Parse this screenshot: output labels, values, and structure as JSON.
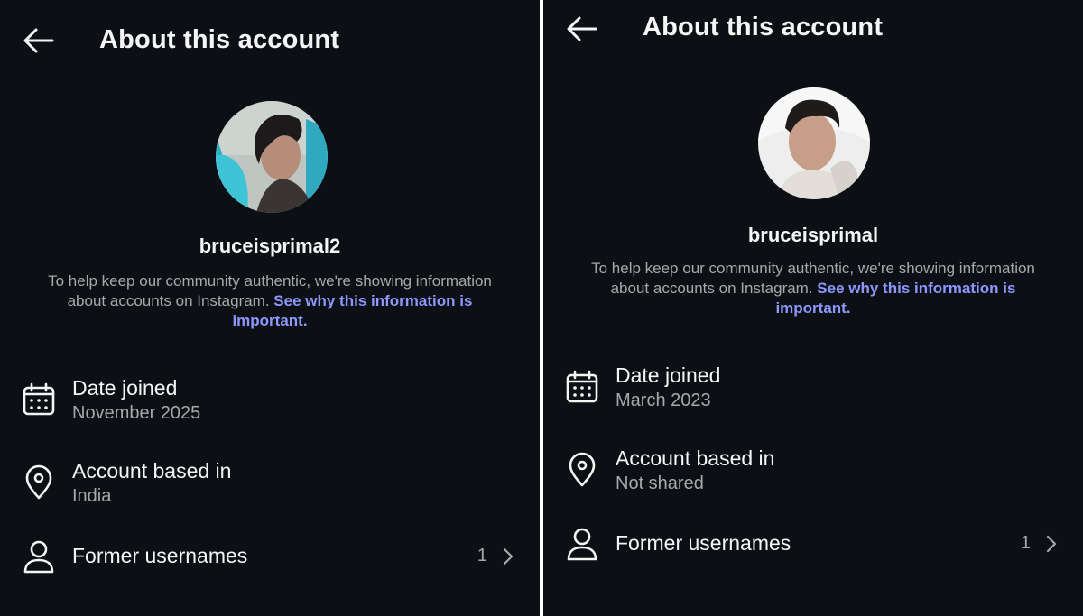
{
  "panels": [
    {
      "header": {
        "title": "About this account",
        "back_icon": "arrow-left-icon"
      },
      "avatar": {
        "icon": "profile-photo",
        "bg_colors": [
          "#3fb7c9",
          "#d9dadb"
        ]
      },
      "username": "bruceisprimal2",
      "info": {
        "text": "To help keep our community authentic, we're showing information about accounts on Instagram. ",
        "link": "See why this information is important",
        "end": "."
      },
      "date_joined": {
        "icon": "calendar-icon",
        "label": "Date joined",
        "value": "November 2025"
      },
      "based_in": {
        "icon": "location-pin-icon",
        "label": "Account based in",
        "value": "India"
      },
      "former_usernames": {
        "icon": "person-icon",
        "label": "Former usernames",
        "count": "1",
        "chevron": "chevron-right-icon"
      }
    },
    {
      "header": {
        "title": "About this account",
        "back_icon": "arrow-left-icon"
      },
      "avatar": {
        "icon": "profile-photo",
        "bg_colors": [
          "#f0f0f0",
          "#b08a76"
        ]
      },
      "username": "bruceisprimal",
      "info": {
        "text": "To help keep our community authentic, we're showing information about accounts on Instagram. ",
        "link": "See why this information is important",
        "end": "."
      },
      "date_joined": {
        "icon": "calendar-icon",
        "label": "Date joined",
        "value": "March 2023"
      },
      "based_in": {
        "icon": "location-pin-icon",
        "label": "Account based in",
        "value": "Not shared"
      },
      "former_usernames": {
        "icon": "person-icon",
        "label": "Former usernames",
        "count": "1",
        "chevron": "chevron-right-icon"
      }
    }
  ],
  "colors": {
    "background": "#0c1014",
    "text": "#f5f5f5",
    "secondary": "#a8a8a8",
    "link": "#8d97ff"
  }
}
